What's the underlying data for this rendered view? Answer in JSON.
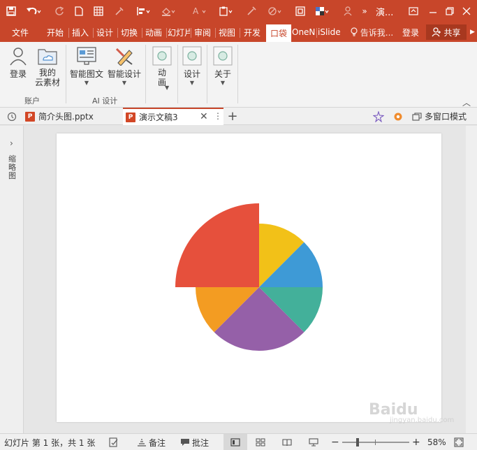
{
  "title": {
    "text": "演..."
  },
  "tabs": [
    {
      "label": "文件"
    },
    {
      "label": "开始"
    },
    {
      "label": "插入"
    },
    {
      "label": "设计"
    },
    {
      "label": "切换"
    },
    {
      "label": "动画"
    },
    {
      "label": "幻灯片"
    },
    {
      "label": "审阅"
    },
    {
      "label": "视图"
    },
    {
      "label": "开发"
    },
    {
      "label": "口袋"
    },
    {
      "label": "OneN"
    },
    {
      "label": "iSlide"
    }
  ],
  "tellme": {
    "label": "告诉我..."
  },
  "signin": {
    "label": "登录"
  },
  "share": {
    "label": "共享"
  },
  "ribbon": {
    "login": {
      "label": "登录"
    },
    "cloud": {
      "label1": "我的",
      "label2": "云素材"
    },
    "group_account": {
      "label": "账户"
    },
    "smart_graphic": {
      "label": "智能图文"
    },
    "smart_design": {
      "label": "智能设计"
    },
    "group_ai": {
      "label": "AI 设计"
    },
    "anim": {
      "label1": "动",
      "label2": "画"
    },
    "design": {
      "label": "设计"
    },
    "about": {
      "label": "关于"
    }
  },
  "doc_tabs": [
    {
      "label": "简介头图.pptx"
    },
    {
      "label": "演示文稿3"
    }
  ],
  "doc_tab_icon": {
    "label": "P"
  },
  "multi_window": {
    "label": "多窗口模式"
  },
  "left_panel": {
    "label": "缩略图"
  },
  "status": {
    "slide_info": "幻灯片 第 1 张，共 1 张",
    "notes": "备注",
    "comments": "批注",
    "zoom": "58%"
  },
  "colors": {
    "accent": "#c8462a",
    "pie_red": "#e6503c",
    "pie_yellow": "#f2c118",
    "pie_blue": "#3e9ad6",
    "pie_teal": "#43b09a",
    "pie_purple": "#9560a8",
    "pie_orange": "#f39c22"
  },
  "slide_pie": {
    "segments": [
      {
        "color": "#f2c118"
      },
      {
        "color": "#3e9ad6"
      },
      {
        "color": "#43b09a"
      },
      {
        "color": "#9560a8"
      },
      {
        "color": "#f39c22"
      },
      {
        "color": "#e6503c"
      }
    ]
  },
  "watermark": {
    "text": "Baidu",
    "sub": "jingyan.baidu.com"
  }
}
